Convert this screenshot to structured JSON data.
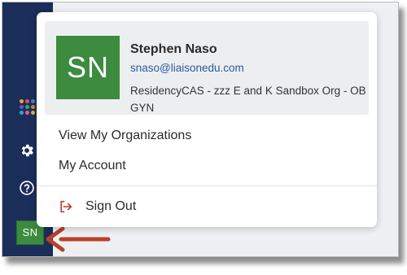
{
  "colors": {
    "sidebar": "#1b2e5a",
    "avatar": "#3c8b3f",
    "email_link": "#2c5aa0",
    "signout_icon": "#c0392b",
    "annotation_arrow": "#b8412a"
  },
  "sidebar": {
    "icons": [
      "apps-grid-icon",
      "gear-icon",
      "help-icon"
    ],
    "avatar_initials": "SN"
  },
  "profile_menu": {
    "avatar_initials": "SN",
    "user_name": "Stephen Naso",
    "email": "snaso@liaisonedu.com",
    "organization": "ResidencyCAS - zzz E and K Sandbox Org - OB GYN",
    "items": [
      {
        "label": "View My Organizations"
      },
      {
        "label": "My Account"
      }
    ],
    "sign_out": {
      "label": "Sign Out",
      "icon": "sign-out-icon"
    }
  }
}
